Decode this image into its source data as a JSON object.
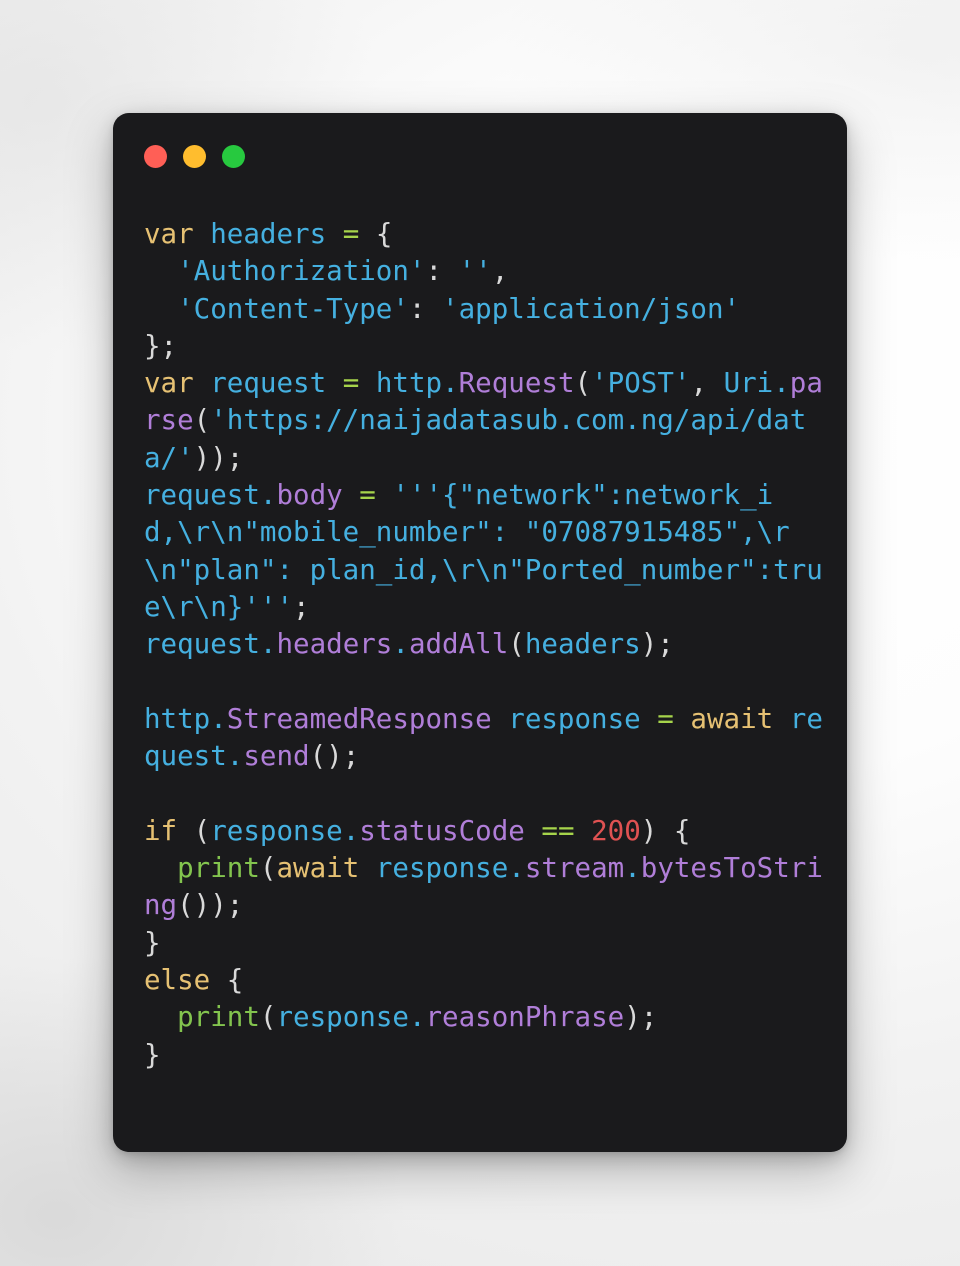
{
  "window": {
    "traffic_lights": [
      {
        "name": "close",
        "color": "#ff5f56"
      },
      {
        "name": "minimize",
        "color": "#ffbd2e"
      },
      {
        "name": "maximize",
        "color": "#27c93f"
      }
    ]
  },
  "theme": {
    "background": "#1a1a1c",
    "page_background": "#f2f2f2",
    "keyword": "#e6c173",
    "variable": "#45b0e0",
    "string": "#45b0e0",
    "property": "#b07ed8",
    "operator": "#a6d44b",
    "number": "#e05252",
    "function": "#83c44e",
    "punctuation": "#d9d9d9"
  },
  "code": {
    "language": "dart",
    "lines": [
      {
        "id": 1,
        "text": "var headers = {",
        "tokens": [
          {
            "t": "var",
            "c": "kw"
          },
          {
            "t": " ",
            "c": "punct"
          },
          {
            "t": "headers",
            "c": "var"
          },
          {
            "t": " ",
            "c": "punct"
          },
          {
            "t": "=",
            "c": "op"
          },
          {
            "t": " ",
            "c": "punct"
          },
          {
            "t": "{",
            "c": "punct"
          }
        ]
      },
      {
        "id": 2,
        "text": "  'Authorization': '',",
        "tokens": [
          {
            "t": "  ",
            "c": "punct"
          },
          {
            "t": "'Authorization'",
            "c": "str"
          },
          {
            "t": ":",
            "c": "punct"
          },
          {
            "t": " ",
            "c": "punct"
          },
          {
            "t": "''",
            "c": "str"
          },
          {
            "t": ",",
            "c": "punct"
          }
        ]
      },
      {
        "id": 3,
        "text": "  'Content-Type': 'application/json'",
        "tokens": [
          {
            "t": "  ",
            "c": "punct"
          },
          {
            "t": "'Content-Type'",
            "c": "str"
          },
          {
            "t": ":",
            "c": "punct"
          },
          {
            "t": " ",
            "c": "punct"
          },
          {
            "t": "'application/json'",
            "c": "str"
          }
        ]
      },
      {
        "id": 4,
        "text": "};",
        "tokens": [
          {
            "t": "};",
            "c": "punct"
          }
        ]
      },
      {
        "id": 5,
        "text": "var request = http.Request('POST', Uri.parse('https://naijadatasub.com.ng/api/data/'));",
        "tokens": [
          {
            "t": "var",
            "c": "kw"
          },
          {
            "t": " ",
            "c": "punct"
          },
          {
            "t": "request",
            "c": "var"
          },
          {
            "t": " ",
            "c": "punct"
          },
          {
            "t": "=",
            "c": "op"
          },
          {
            "t": " ",
            "c": "punct"
          },
          {
            "t": "http",
            "c": "var"
          },
          {
            "t": ".",
            "c": "dot"
          },
          {
            "t": "Request",
            "c": "prop"
          },
          {
            "t": "(",
            "c": "punct"
          },
          {
            "t": "'POST'",
            "c": "str"
          },
          {
            "t": ", ",
            "c": "punct"
          },
          {
            "t": "Uri",
            "c": "var"
          },
          {
            "t": ".",
            "c": "dot"
          },
          {
            "t": "parse",
            "c": "prop"
          },
          {
            "t": "(",
            "c": "punct"
          },
          {
            "t": "'https://naijadatasub.com.ng/api/data/'",
            "c": "str"
          },
          {
            "t": "));",
            "c": "punct"
          }
        ]
      },
      {
        "id": 6,
        "text": "request.body = '''{\"network\":network_id,\\r\\n\"mobile_number\": \"07087915485\",\\r\\n\"plan\": plan_id,\\r\\n\"Ported_number\":true\\r\\n}''';",
        "tokens": [
          {
            "t": "request",
            "c": "var"
          },
          {
            "t": ".",
            "c": "dot"
          },
          {
            "t": "body",
            "c": "prop"
          },
          {
            "t": " ",
            "c": "punct"
          },
          {
            "t": "=",
            "c": "op"
          },
          {
            "t": " ",
            "c": "punct"
          },
          {
            "t": "'''{\"network\":network_id,\\r\\n\"mobile_number\": \"07087915485\",\\r\\n\"plan\": plan_id,\\r\\n\"Ported_number\":true\\r\\n}'''",
            "c": "str"
          },
          {
            "t": ";",
            "c": "punct"
          }
        ]
      },
      {
        "id": 7,
        "text": "request.headers.addAll(headers);",
        "tokens": [
          {
            "t": "request",
            "c": "var"
          },
          {
            "t": ".",
            "c": "dot"
          },
          {
            "t": "headers",
            "c": "prop"
          },
          {
            "t": ".",
            "c": "dot"
          },
          {
            "t": "addAll",
            "c": "prop"
          },
          {
            "t": "(",
            "c": "punct"
          },
          {
            "t": "headers",
            "c": "var"
          },
          {
            "t": ");",
            "c": "punct"
          }
        ]
      },
      {
        "id": 8,
        "text": "",
        "tokens": []
      },
      {
        "id": 9,
        "text": "http.StreamedResponse response = await request.send();",
        "tokens": [
          {
            "t": "http",
            "c": "var"
          },
          {
            "t": ".",
            "c": "dot"
          },
          {
            "t": "StreamedResponse",
            "c": "prop"
          },
          {
            "t": " ",
            "c": "punct"
          },
          {
            "t": "response",
            "c": "var"
          },
          {
            "t": " ",
            "c": "punct"
          },
          {
            "t": "=",
            "c": "op"
          },
          {
            "t": " ",
            "c": "punct"
          },
          {
            "t": "await",
            "c": "kw"
          },
          {
            "t": " ",
            "c": "punct"
          },
          {
            "t": "request",
            "c": "var"
          },
          {
            "t": ".",
            "c": "dot"
          },
          {
            "t": "send",
            "c": "prop"
          },
          {
            "t": "();",
            "c": "punct"
          }
        ]
      },
      {
        "id": 10,
        "text": "",
        "tokens": []
      },
      {
        "id": 11,
        "text": "if (response.statusCode == 200) {",
        "tokens": [
          {
            "t": "if",
            "c": "kw"
          },
          {
            "t": " (",
            "c": "punct"
          },
          {
            "t": "response",
            "c": "var"
          },
          {
            "t": ".",
            "c": "dot"
          },
          {
            "t": "statusCode",
            "c": "prop"
          },
          {
            "t": " ",
            "c": "punct"
          },
          {
            "t": "==",
            "c": "op"
          },
          {
            "t": " ",
            "c": "punct"
          },
          {
            "t": "200",
            "c": "num"
          },
          {
            "t": ") {",
            "c": "punct"
          }
        ]
      },
      {
        "id": 12,
        "text": "  print(await response.stream.bytesToString());",
        "tokens": [
          {
            "t": "  ",
            "c": "punct"
          },
          {
            "t": "print",
            "c": "fn"
          },
          {
            "t": "(",
            "c": "punct"
          },
          {
            "t": "await",
            "c": "kw"
          },
          {
            "t": " ",
            "c": "punct"
          },
          {
            "t": "response",
            "c": "var"
          },
          {
            "t": ".",
            "c": "dot"
          },
          {
            "t": "stream",
            "c": "prop"
          },
          {
            "t": ".",
            "c": "dot"
          },
          {
            "t": "bytesToString",
            "c": "prop"
          },
          {
            "t": "());",
            "c": "punct"
          }
        ]
      },
      {
        "id": 13,
        "text": "}",
        "tokens": [
          {
            "t": "}",
            "c": "punct"
          }
        ]
      },
      {
        "id": 14,
        "text": "else {",
        "tokens": [
          {
            "t": "else",
            "c": "kw"
          },
          {
            "t": " {",
            "c": "punct"
          }
        ]
      },
      {
        "id": 15,
        "text": "  print(response.reasonPhrase);",
        "tokens": [
          {
            "t": "  ",
            "c": "punct"
          },
          {
            "t": "print",
            "c": "fn"
          },
          {
            "t": "(",
            "c": "punct"
          },
          {
            "t": "response",
            "c": "var"
          },
          {
            "t": ".",
            "c": "dot"
          },
          {
            "t": "reasonPhrase",
            "c": "prop"
          },
          {
            "t": ");",
            "c": "punct"
          }
        ]
      },
      {
        "id": 16,
        "text": "}",
        "tokens": [
          {
            "t": "}",
            "c": "punct"
          }
        ]
      }
    ]
  }
}
